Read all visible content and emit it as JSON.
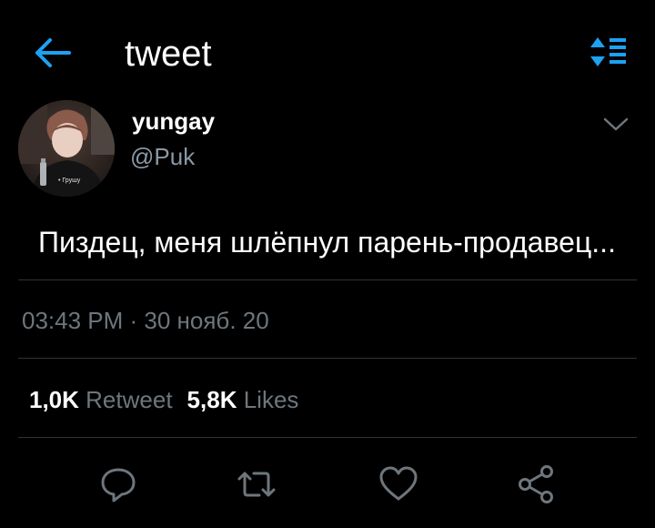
{
  "header": {
    "title": "tweet",
    "back_icon": "arrow-left-icon",
    "sort_icon": "sort-list-icon",
    "accent_color": "#1da1f2"
  },
  "tweet": {
    "display_name": "yungay",
    "handle": "@Puk",
    "avatar_caption": "• Грушу",
    "text": "Пиздец, меня шлёпнул парень-продавец...",
    "timestamp": "03:43 PM · 30 нояб. 20",
    "menu_icon": "chevron-down-icon"
  },
  "stats": {
    "retweets_count": "1,0K",
    "retweets_label": "Retweet",
    "likes_count": "5,8K",
    "likes_label": "Likes"
  },
  "actions": [
    {
      "name": "reply",
      "icon": "comment-icon"
    },
    {
      "name": "retweet",
      "icon": "retweet-icon"
    },
    {
      "name": "like",
      "icon": "heart-icon"
    },
    {
      "name": "share",
      "icon": "share-icon"
    }
  ],
  "colors": {
    "background": "#000000",
    "text": "#ffffff",
    "muted": "#6e767d",
    "divider": "#2f3336"
  }
}
